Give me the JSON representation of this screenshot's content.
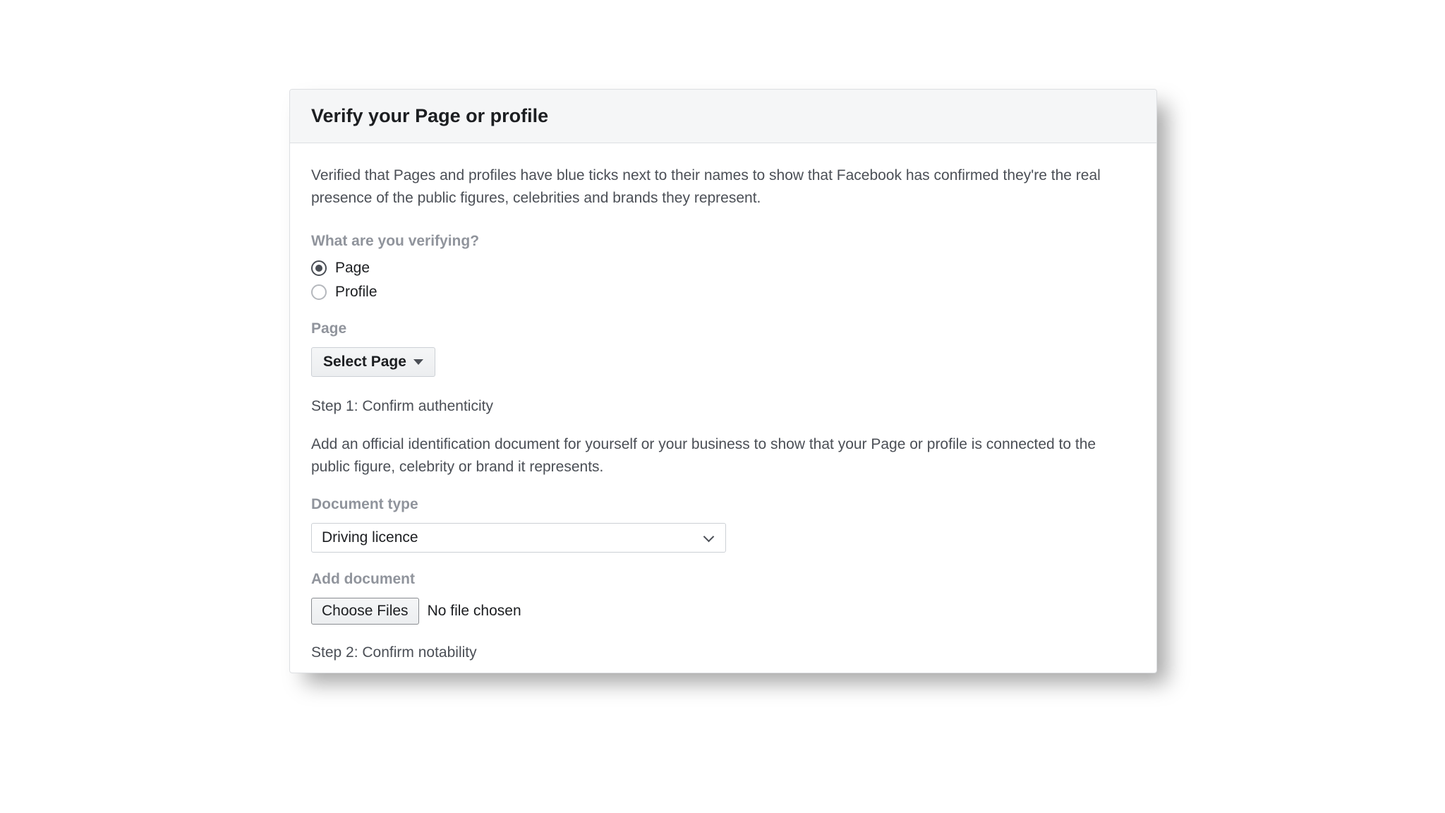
{
  "header": {
    "title": "Verify your Page or profile"
  },
  "intro": "Verified that Pages and profiles have blue ticks next to their names to show that Facebook has confirmed they're the real presence of the public figures, celebrities and brands they represent.",
  "verifying": {
    "label": "What are you verifying?",
    "options": {
      "page": "Page",
      "profile": "Profile"
    }
  },
  "page_section": {
    "label": "Page",
    "select_button": "Select Page"
  },
  "step1": {
    "title": "Step 1: Confirm authenticity",
    "description": "Add an official identification document for yourself or your business to show that your Page or profile is connected to the public figure, celebrity or brand it represents."
  },
  "document_type": {
    "label": "Document type",
    "selected": "Driving licence"
  },
  "add_document": {
    "label": "Add document",
    "button": "Choose Files",
    "status": "No file chosen"
  },
  "step2": {
    "title": "Step 2: Confirm notability"
  }
}
